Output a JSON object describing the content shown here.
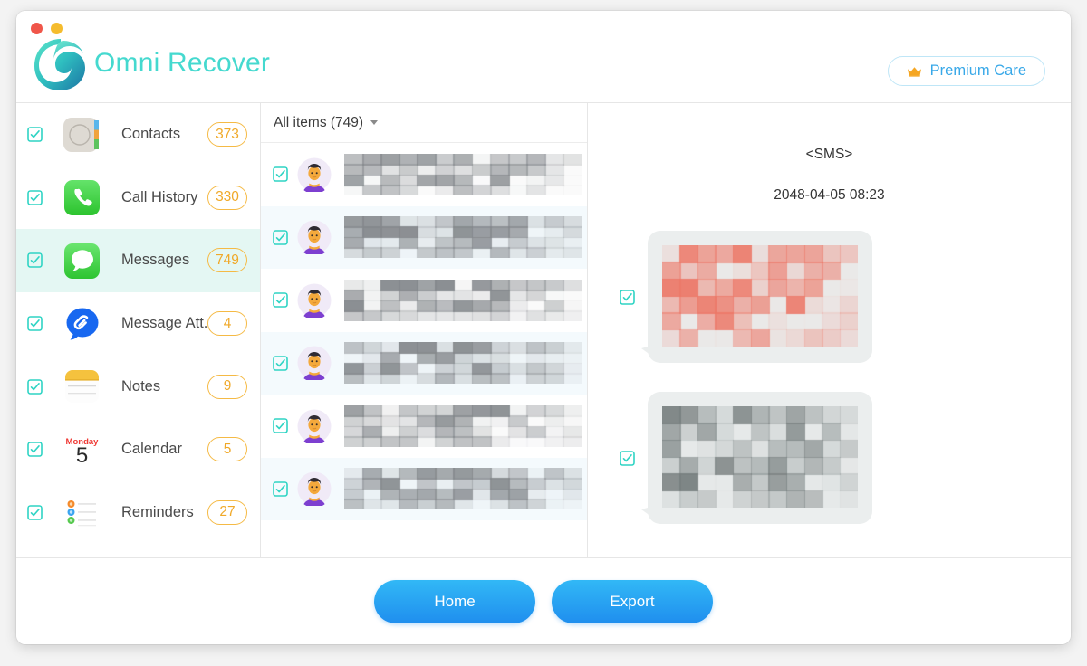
{
  "app": {
    "name": "Omni Recover",
    "brand_color": "#45d9cf"
  },
  "titlebar": {
    "close_dot": "close-dot",
    "minimize_dot": "minimize-dot",
    "premium": {
      "label": "Premium Care",
      "icon": "crown-icon",
      "text_color": "#38a8e8",
      "icon_color": "#f5a623"
    }
  },
  "sidebar": {
    "items": [
      {
        "label": "Contacts",
        "count": "373",
        "icon": "contacts-icon",
        "checked": true,
        "selected": false
      },
      {
        "label": "Call History",
        "count": "330",
        "icon": "phone-icon",
        "checked": true,
        "selected": false
      },
      {
        "label": "Messages",
        "count": "749",
        "icon": "message-bubble-icon",
        "checked": true,
        "selected": true
      },
      {
        "label": "Message Att...",
        "count": "4",
        "icon": "attachment-bubble-icon",
        "checked": true,
        "selected": false
      },
      {
        "label": "Notes",
        "count": "9",
        "icon": "notes-icon",
        "checked": true,
        "selected": false
      },
      {
        "label": "Calendar",
        "count": "5",
        "icon": "calendar-icon",
        "checked": true,
        "selected": false
      },
      {
        "label": "Reminders",
        "count": "27",
        "icon": "reminders-icon",
        "checked": true,
        "selected": false
      }
    ],
    "badge_color": "#f0a929",
    "selected_bg": "#e4f7f3"
  },
  "calendar_icon": {
    "weekday": "Monday",
    "day": "5"
  },
  "list": {
    "header_label": "All items (749)",
    "dropdown_icon": "chevron-down-icon",
    "rows": [
      {
        "avatar": "person-avatar",
        "checked": true,
        "content": "redacted"
      },
      {
        "avatar": "person-avatar",
        "checked": true,
        "content": "redacted"
      },
      {
        "avatar": "person-avatar",
        "checked": true,
        "content": "redacted"
      },
      {
        "avatar": "person-avatar",
        "checked": true,
        "content": "redacted"
      },
      {
        "avatar": "person-avatar",
        "checked": true,
        "content": "redacted"
      },
      {
        "avatar": "person-avatar",
        "checked": true,
        "content": "redacted"
      }
    ]
  },
  "detail": {
    "title": "<SMS>",
    "date": "2048-04-05 08:23",
    "messages": [
      {
        "checked": true,
        "content": "redacted",
        "tint": "#f4b3ab"
      },
      {
        "checked": true,
        "content": "redacted",
        "tint": "#c4c9c9"
      }
    ]
  },
  "footer": {
    "home_label": "Home",
    "export_label": "Export",
    "button_color": "#1f8eee"
  }
}
